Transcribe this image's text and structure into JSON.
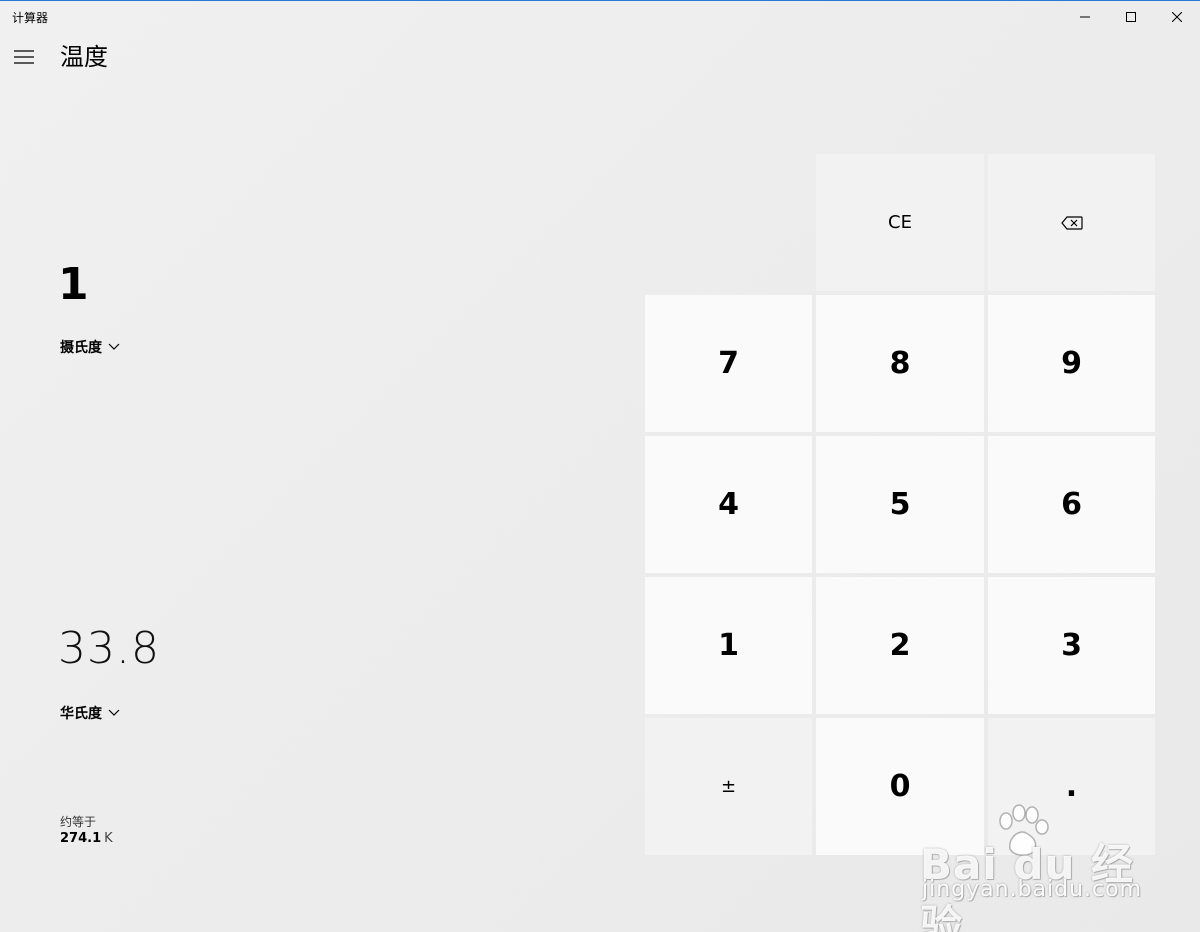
{
  "window": {
    "title": "计算器",
    "controls": {
      "minimize": "minimize",
      "maximize": "maximize",
      "close": "close"
    }
  },
  "header": {
    "menu_icon": "hamburger-menu-icon",
    "mode_title": "温度"
  },
  "display": {
    "from_value": "1",
    "from_unit": "摄氏度",
    "to_value": "33.8",
    "to_unit": "华氏度",
    "approx_label": "约等于",
    "approx_value": "274.1",
    "approx_unit": "K"
  },
  "keypad": {
    "ce": "CE",
    "backspace_icon": "backspace-icon",
    "k7": "7",
    "k8": "8",
    "k9": "9",
    "k4": "4",
    "k5": "5",
    "k6": "6",
    "k1": "1",
    "k2": "2",
    "k3": "3",
    "negate": "±",
    "k0": "0",
    "decimal": "."
  },
  "watermark": {
    "logo": "Bai du 经验",
    "url": "jingyan.baidu.com"
  },
  "colors": {
    "accent_border": "#2b78d4",
    "digit_key_bg": "#fafafa",
    "op_key_bg": "#f2f2f2",
    "background": "#ececec"
  }
}
